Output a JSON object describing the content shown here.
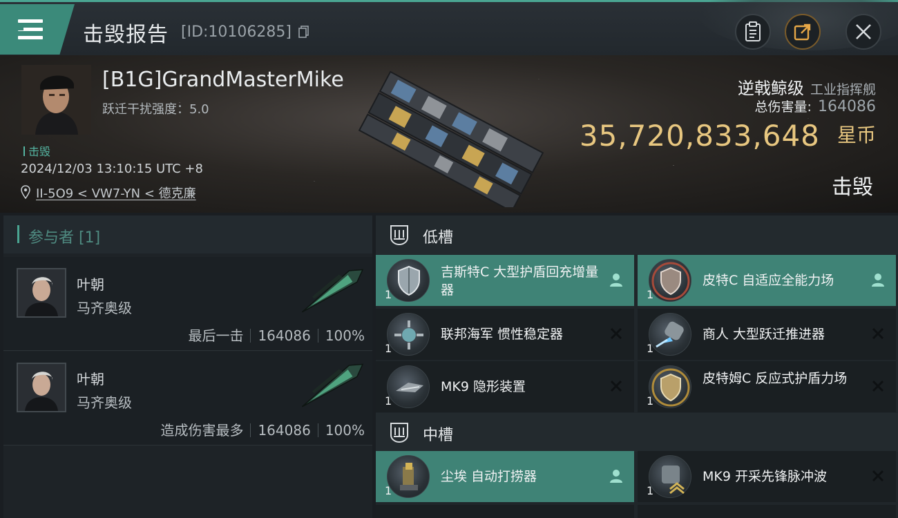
{
  "topbar": {
    "title": "击毁报告",
    "id_label": "[ID:10106285]"
  },
  "victim": {
    "name": "[B1G]GrandMasterMike",
    "warp_disrupt": "跃迁干扰强度：5.0",
    "kill_tag": "击毁",
    "time": "2024/12/03 13:10:15 UTC +8",
    "location": "II-5O9 < VW7-YN < 德克廉",
    "ship_class": "逆戟鲸级",
    "ship_category": "工业指挥舰",
    "damage_label": "总伤害量:",
    "damage_value": "164086",
    "isk_value": "35,720,833,648",
    "isk_unit": "星币",
    "result": "击毁"
  },
  "participants": {
    "header": "参与者 [1]",
    "rows": [
      {
        "name": "叶朝",
        "ship": "马齐奥级",
        "stat_label": "最后一击",
        "damage": "164086",
        "percent": "100%"
      },
      {
        "name": "叶朝",
        "ship": "马齐奥级",
        "stat_label": "造成伤害最多",
        "damage": "164086",
        "percent": "100%"
      }
    ]
  },
  "slots": {
    "low_label": "低槽",
    "mid_label": "中槽",
    "low": [
      {
        "name": "吉斯特C 大型护盾回充增量器",
        "qty": "1",
        "status": "dropped",
        "icon": "shield-icon"
      },
      {
        "name": "皮特C 自适应全能力场",
        "qty": "1",
        "status": "dropped",
        "icon": "shield-icon"
      },
      {
        "name": "联邦海军 惯性稳定器",
        "qty": "1",
        "status": "destroyed",
        "icon": "stabilizer-icon"
      },
      {
        "name": "商人 大型跃迁推进器",
        "qty": "1",
        "status": "destroyed",
        "icon": "thruster-icon"
      },
      {
        "name": "MK9 隐形装置",
        "qty": "1",
        "status": "destroyed",
        "icon": "cloak-icon"
      },
      {
        "name": "皮特姆C 反应式护盾力场",
        "qty": "1",
        "status": "destroyed",
        "icon": "shield-icon"
      }
    ],
    "mid": [
      {
        "name": "尘埃 自动打捞器",
        "qty": "1",
        "status": "dropped",
        "icon": "salvager-icon"
      },
      {
        "name": "MK9 开采先锋脉冲波",
        "qty": "1",
        "status": "destroyed",
        "icon": "mining-pulse-icon"
      }
    ]
  },
  "colors": {
    "accent": "#4aa592",
    "isk": "#e8c780",
    "dropped_bg": "#3f8376"
  }
}
